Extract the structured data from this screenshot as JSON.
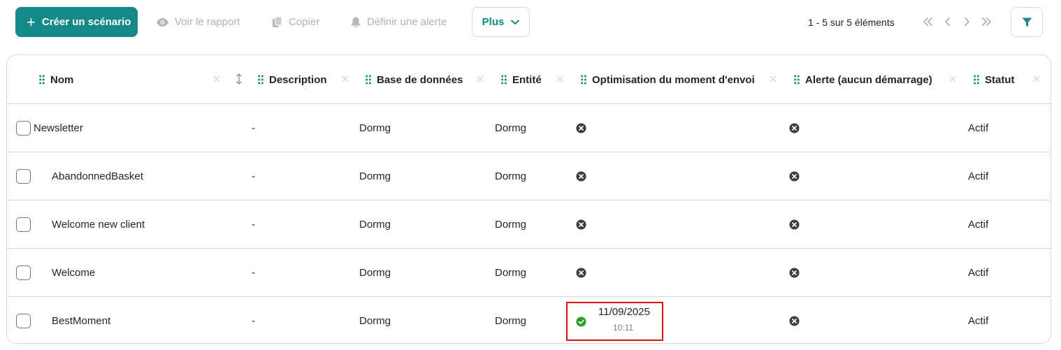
{
  "toolbar": {
    "create_label": "Créer un scénario",
    "view_report_label": "Voir le rapport",
    "copy_label": "Copier",
    "alert_label": "Définir une alerte",
    "more_label": "Plus",
    "pager_text": "1 - 5 sur 5 éléments"
  },
  "colors": {
    "accent": "#15888a",
    "disabled": "#aeb3b7",
    "highlight": "#dd1111",
    "success": "#2f9e2f",
    "neutral_icon": "#3a3f44"
  },
  "table": {
    "columns": [
      {
        "label": "Nom"
      },
      {
        "label": "Description"
      },
      {
        "label": "Base de données"
      },
      {
        "label": "Entité"
      },
      {
        "label": "Optimisation du moment d'envoi"
      },
      {
        "label": "Alerte (aucun démarrage)"
      },
      {
        "label": "Statut"
      }
    ],
    "rows": [
      {
        "name": "Newsletter",
        "description": "-",
        "database": "Dormg",
        "entity": "Dormg",
        "send_time": {
          "icon": "x-circle-icon"
        },
        "alert": {
          "icon": "x-circle-icon"
        },
        "status": "Actif"
      },
      {
        "name": "AbandonnedBasket",
        "description": "-",
        "database": "Dormg",
        "entity": "Dormg",
        "send_time": {
          "icon": "x-circle-icon"
        },
        "alert": {
          "icon": "x-circle-icon"
        },
        "status": "Actif"
      },
      {
        "name": "Welcome new client",
        "description": "-",
        "database": "Dormg",
        "entity": "Dormg",
        "send_time": {
          "icon": "x-circle-icon"
        },
        "alert": {
          "icon": "x-circle-icon"
        },
        "status": "Actif"
      },
      {
        "name": "Welcome",
        "description": "-",
        "database": "Dormg",
        "entity": "Dormg",
        "send_time": {
          "icon": "x-circle-icon"
        },
        "alert": {
          "icon": "x-circle-icon"
        },
        "status": "Actif"
      },
      {
        "name": "BestMoment",
        "description": "-",
        "database": "Dormg",
        "entity": "Dormg",
        "send_time": {
          "icon": "check-circle-icon",
          "date": "11/09/2025",
          "time": "10:11"
        },
        "alert": {
          "icon": "x-circle-icon"
        },
        "status": "Actif"
      }
    ]
  }
}
